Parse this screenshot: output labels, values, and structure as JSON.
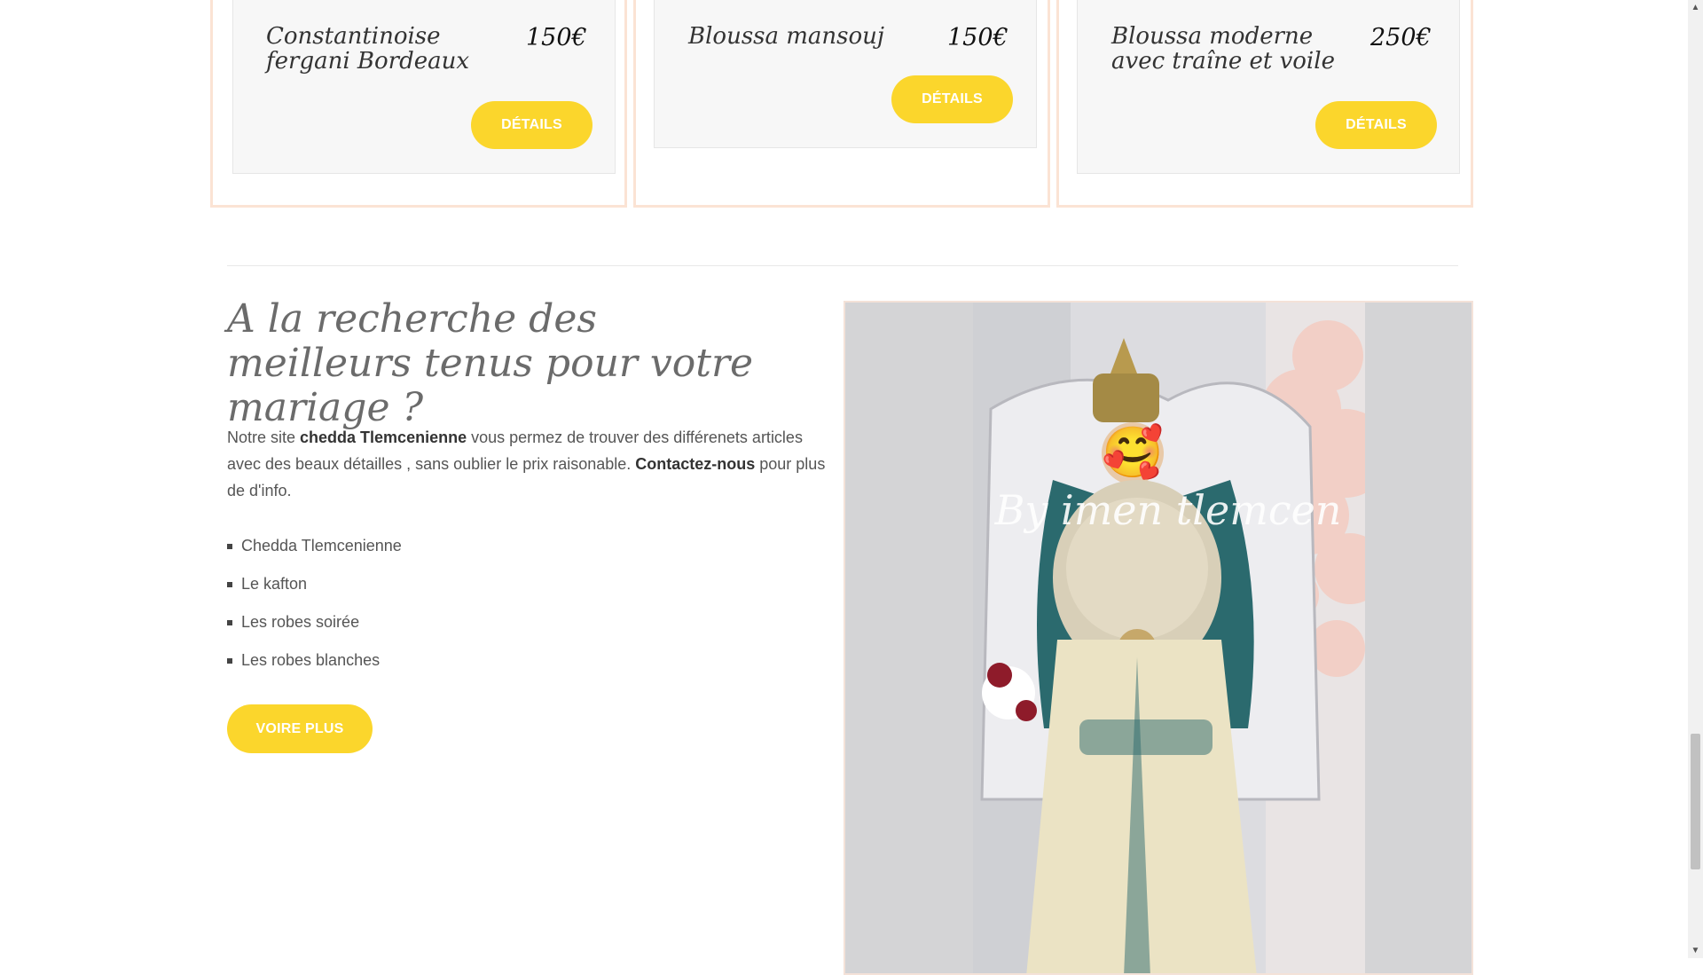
{
  "products": [
    {
      "name": "Constantinoise fergani Bordeaux",
      "price": "150€",
      "button": "DÉTAILS"
    },
    {
      "name": "Bloussa mansouj",
      "price": "150€",
      "button": "DÉTAILS"
    },
    {
      "name": "Bloussa moderne avec traîne et voile",
      "price": "250€",
      "button": "DÉTAILS"
    }
  ],
  "intro": {
    "heading": "A la recherche des meilleurs tenus pour votre mariage ?",
    "para_1": "Notre site ",
    "para_bold_1": "chedda Tlemcenienne",
    "para_2": " vous permez de trouver des différenets articles avec des beaux détailles , sans oublier le prix raisonable. ",
    "para_bold_2": "Contactez-nous",
    "para_3": " pour plus de d'info.",
    "list": [
      "Chedda Tlemcenienne",
      "Le kafton",
      "Les robes soirée",
      "Les robes blanches"
    ],
    "button": "VOIRE PLUS"
  },
  "photo": {
    "watermark": "By imen tlemcen",
    "emoji": "🥰"
  },
  "colors": {
    "accent": "#fbd62c",
    "card_bg": "#f7f7f7",
    "border_peach": "#fbe3d4"
  }
}
